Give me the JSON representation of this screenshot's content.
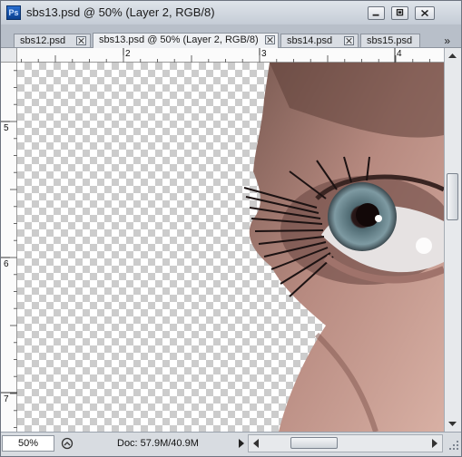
{
  "window": {
    "app_icon": "photoshop-icon",
    "app_icon_text": "Ps",
    "title": "sbs13.psd @ 50% (Layer 2, RGB/8)"
  },
  "tabs": [
    {
      "label": "sbs12.psd",
      "active": false
    },
    {
      "label": "sbs13.psd @ 50% (Layer 2, RGB/8)",
      "active": true
    },
    {
      "label": "sbs14.psd",
      "active": false
    },
    {
      "label": "sbs15.psd",
      "active": false
    }
  ],
  "tab_overflow": "»",
  "ruler": {
    "top_labels": [
      "2",
      "3",
      "4"
    ],
    "left_labels": [
      "5",
      "6",
      "7"
    ]
  },
  "status": {
    "zoom": "50%",
    "doc_info": "Doc: 57.9M/40.9M"
  }
}
